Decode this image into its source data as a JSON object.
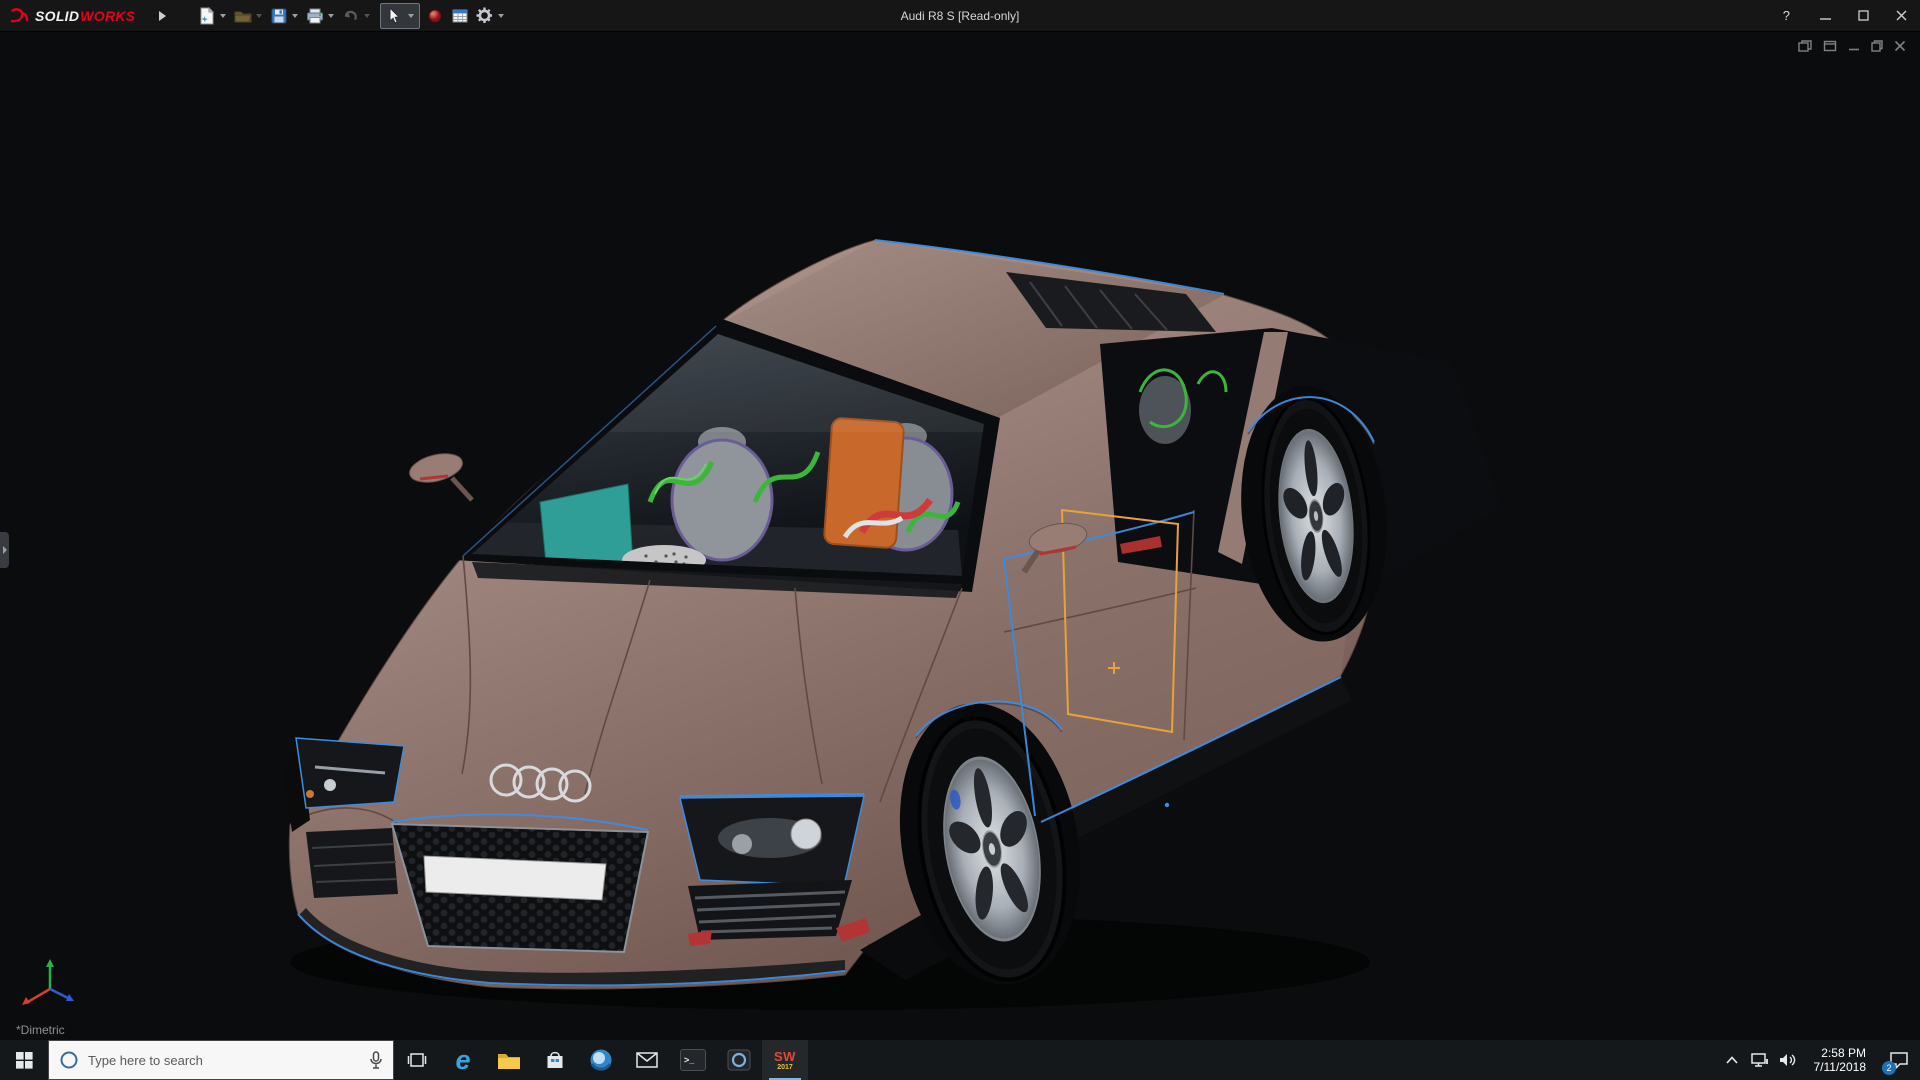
{
  "titlebar": {
    "logo_solid": "SOLID",
    "logo_works": "WORKS",
    "document_title": "Audi R8 S [Read-only]",
    "help_glyph": "?",
    "toolbar_icons": [
      "new-document",
      "open-document",
      "save",
      "print",
      "undo",
      "select",
      "appearance",
      "design-table",
      "options"
    ]
  },
  "viewport": {
    "view_label": "*Dimetric",
    "doc_controls": [
      "float-window",
      "dock-window",
      "minimize-document",
      "restore-document",
      "close-document"
    ]
  },
  "taskbar": {
    "search_placeholder": "Type here to search",
    "edge_glyph": "e",
    "cmd_glyph": ">_",
    "solidworks_label": "SW",
    "solidworks_year": "2017",
    "time": "2:58 PM",
    "date": "7/11/2018",
    "notification_count": "2"
  },
  "colors": {
    "brand_red": "#e2001a",
    "car_body": "#998078",
    "edge_highlight_blue": "#3f8ce0",
    "selection_orange": "#e8a23c"
  }
}
